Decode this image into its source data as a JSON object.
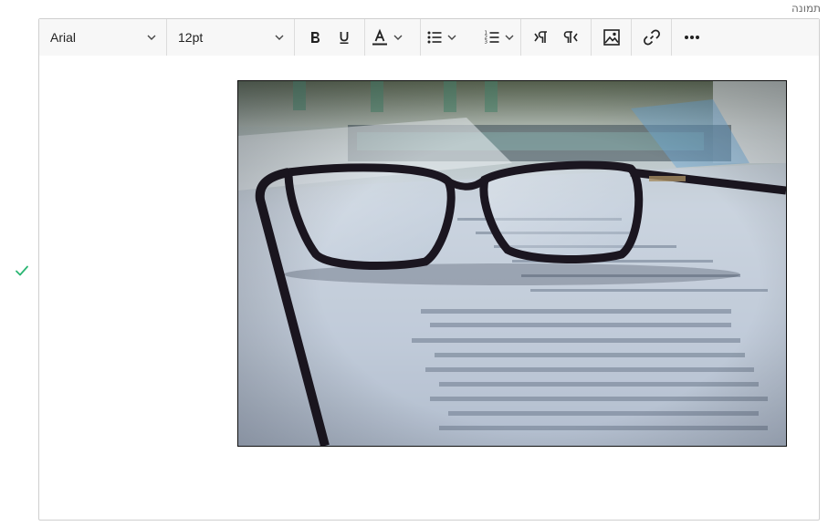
{
  "field": {
    "label": "תמונה"
  },
  "toolbar": {
    "font_family": "Arial",
    "font_size": "12pt"
  },
  "colors": {
    "check": "#2bb673",
    "toolbar_bg": "#f7f7f7",
    "border": "#cfcfcf"
  },
  "icons": {
    "bold": "bold-icon",
    "underline": "underline-icon",
    "text_color": "text-color-icon",
    "bullet_list": "bullet-list-icon",
    "numbered_list": "numbered-list-icon",
    "ltr": "ltr-paragraph-icon",
    "rtl": "rtl-paragraph-icon",
    "image": "image-icon",
    "link": "link-icon",
    "more": "more-icon"
  },
  "image": {
    "subject": "eyeglasses on document"
  }
}
